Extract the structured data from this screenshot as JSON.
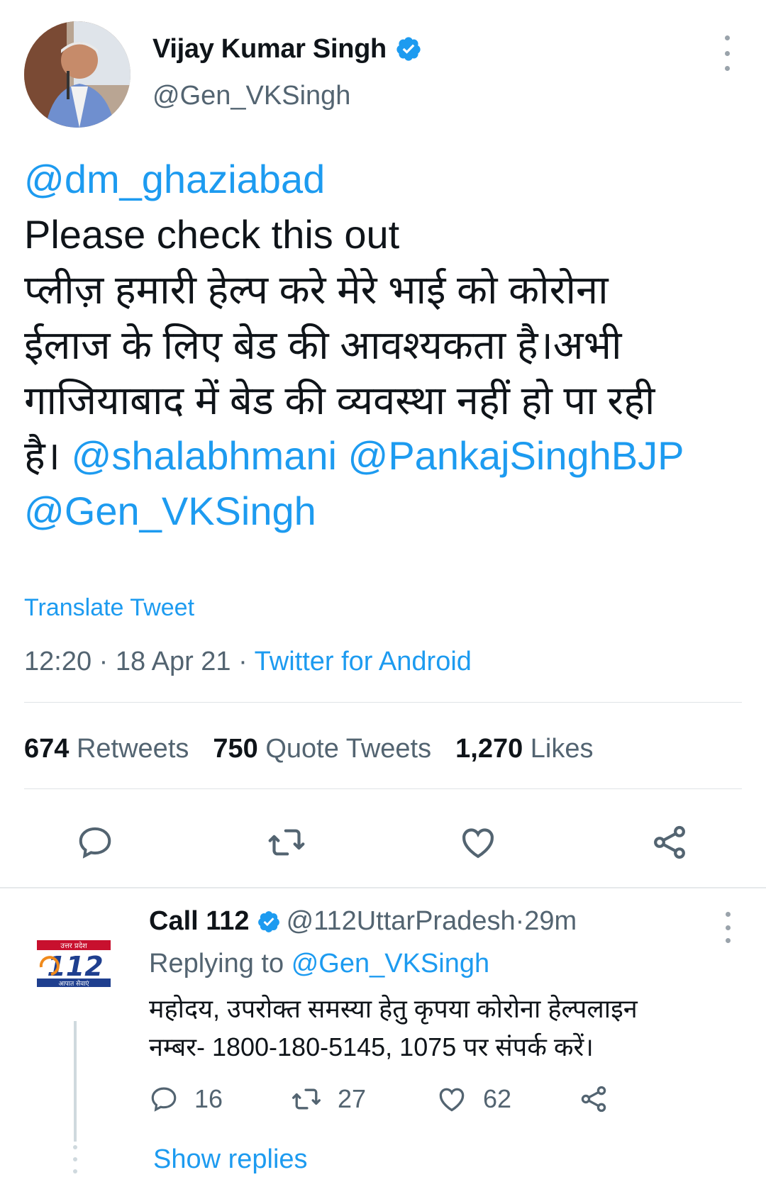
{
  "tweet": {
    "author": {
      "display_name": "Vijay Kumar Singh",
      "handle": "@Gen_VKSingh",
      "verified": true
    },
    "text_lines": [
      [
        {
          "text": "@dm_ghaziabad",
          "mention": true
        }
      ],
      [
        {
          "text": "Please check this out",
          "mention": false
        }
      ],
      [
        {
          "text": "प्लीज़ हमारी हेल्प करे मेरे भाई को कोरोना",
          "mention": false
        }
      ],
      [
        {
          "text": "ईलाज के लिए बेड की आवश्यकता है।अभी",
          "mention": false
        }
      ],
      [
        {
          "text": "गाजियाबाद में बेड की व्यवस्था नहीं हो पा रही",
          "mention": false
        }
      ],
      [
        {
          "text": "है। ",
          "mention": false
        },
        {
          "text": "@shalabhmani",
          "mention": true
        },
        {
          "text": " ",
          "mention": false
        },
        {
          "text": "@PankajSinghBJP",
          "mention": true
        }
      ],
      [
        {
          "text": "@Gen_VKSingh",
          "mention": true
        }
      ]
    ],
    "translate_label": "Translate Tweet",
    "time": "12:20",
    "date": "18 Apr 21",
    "separator": " · ",
    "source": "Twitter for Android",
    "stats": {
      "retweets_count": "674",
      "retweets_label": "Retweets",
      "quotes_count": "750",
      "quotes_label": "Quote Tweets",
      "likes_count": "1,270",
      "likes_label": "Likes"
    },
    "actions": [
      "reply-icon",
      "retweet-icon",
      "like-icon",
      "share-icon"
    ]
  },
  "reply": {
    "logo_text_top": "उत्तर प्रदेश",
    "logo_number": "112",
    "logo_text_bottom": "आपात सेवाएं",
    "display_name": "Call 112",
    "verified": true,
    "handle": "@112UttarPradesh",
    "time_ago": "29m",
    "replying_to_label": "Replying to",
    "replying_to_handle": "@Gen_VKSingh",
    "text_lines": [
      "महोदय, उपरोक्त समस्या हेतु कृपया कोरोना हेल्पलाइन",
      "नम्बर- 1800-180-5145, 1075 पर संपर्क करें।"
    ],
    "reply_count": "16",
    "retweet_count": "27",
    "like_count": "62",
    "show_replies_label": "Show replies"
  },
  "colors": {
    "accent": "#1d9bf0",
    "text": "#0f1419",
    "secondary": "#536471",
    "divider": "#dfe3e6"
  }
}
